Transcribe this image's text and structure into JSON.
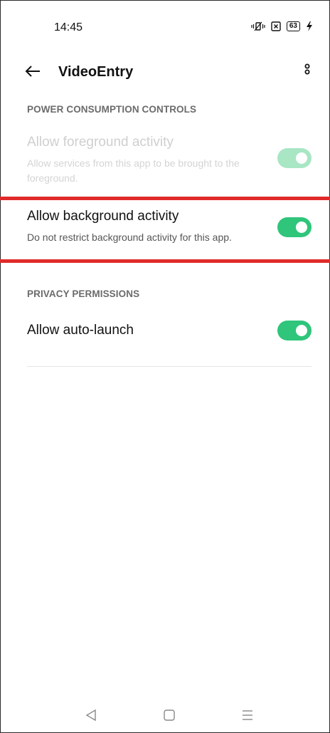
{
  "status_bar": {
    "time": "14:45",
    "battery_level": "63",
    "icons": [
      "vibrate-icon",
      "sim-off-icon",
      "battery-icon",
      "charging-icon"
    ]
  },
  "toolbar": {
    "title": "VideoEntry",
    "back_icon": "back-arrow-icon",
    "overflow_icon": "more-vert-icon"
  },
  "sections": {
    "power": {
      "header": "POWER CONSUMPTION CONTROLS",
      "items": [
        {
          "title": "Allow foreground activity",
          "description": "Allow services from this app to be brought to the foreground.",
          "enabled": true,
          "disabled": true
        },
        {
          "title": "Allow background activity",
          "description": "Do not restrict background activity for this app.",
          "enabled": true,
          "disabled": false
        }
      ]
    },
    "privacy": {
      "header": "PRIVACY PERMISSIONS",
      "items": [
        {
          "title": "Allow auto-launch",
          "enabled": true,
          "disabled": false
        }
      ]
    }
  },
  "colors": {
    "toggle_on": "#2fc57a",
    "toggle_disabled": "#a8e6c4",
    "highlight": "#e02b2b"
  },
  "nav_bar": {
    "icons": [
      "nav-back-icon",
      "nav-home-icon",
      "nav-recents-icon"
    ]
  }
}
